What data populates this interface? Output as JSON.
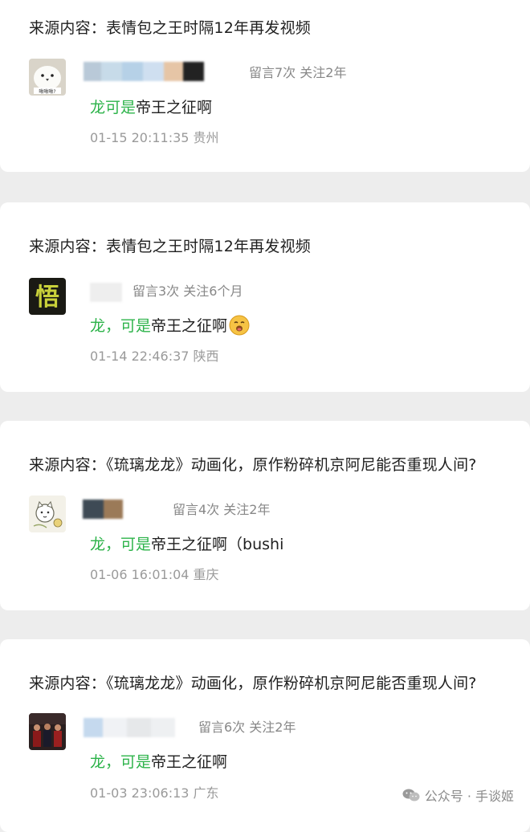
{
  "comments": [
    {
      "source": "来源内容：表情包之王时隔12年再发视频",
      "meta": "留言7次 关注2年",
      "comment_prefix": "龙",
      "comment_green": " 可是",
      "comment_rest": "帝王之征啊",
      "timestamp": "01-15 20:11:35 贵州",
      "avatar_caption": "啾啾啾?",
      "avatar_icon": "white-bird-avatar-icon"
    },
    {
      "source": "来源内容：表情包之王时隔12年再发视频",
      "meta": "留言3次 关注6个月",
      "comment_prefix": "龙",
      "comment_green": "，可是",
      "comment_rest": "帝王之征啊",
      "timestamp": "01-14 22:46:37 陕西",
      "avatar_glyph": "悟",
      "avatar_icon": "calligraphy-avatar-icon",
      "emoji_icon": "cheeky-face-emoji-icon"
    },
    {
      "source": "来源内容：《琉璃龙龙》动画化，原作粉碎机京阿尼能否重现人间?",
      "meta": "留言4次 关注2年",
      "comment_prefix": "龙",
      "comment_green": "，可是",
      "comment_rest": "帝王之征啊（bushi",
      "timestamp": "01-06 16:01:04 重庆",
      "avatar_icon": "cartoon-cat-avatar-icon"
    },
    {
      "source": "来源内容：《琉璃龙龙》动画化，原作粉碎机京阿尼能否重现人间?",
      "meta": "留言6次 关注2年",
      "comment_prefix": "龙",
      "comment_green": "，可是",
      "comment_rest": "帝王之征啊",
      "timestamp": "01-03 23:06:13 广东",
      "avatar_icon": "group-photo-avatar-icon"
    }
  ],
  "watermark": {
    "label": "公众号 · 手谈姬",
    "icon": "wechat-official-account-icon"
  },
  "colors": {
    "accent_green": "#2db34a",
    "page_background": "#ededed",
    "card_background": "#ffffff"
  }
}
